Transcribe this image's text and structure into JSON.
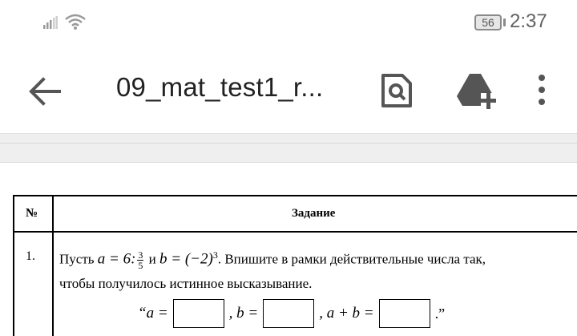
{
  "status_bar": {
    "battery": "56",
    "time": "2:37"
  },
  "app_bar": {
    "title": "09_mat_test1_r...",
    "icons": [
      "back-arrow-icon",
      "find-in-page-icon",
      "drive-add-icon",
      "more-vert-icon"
    ]
  },
  "document": {
    "table": {
      "headers": {
        "number": "№",
        "task": "Задание"
      },
      "rows": [
        {
          "number": "1.",
          "text_prefix": "Пусть ",
          "a_eq": "a = 6:",
          "frac_num": "3",
          "frac_den": "5",
          "and": " и ",
          "b_eq": "b = (−2)",
          "b_exp": "3",
          "text_suffix": ". Впишите в рамки действительные числа так,",
          "text_line2": "чтобы получилось истинное высказывание.",
          "answer": {
            "open_quote_a": "“a =",
            "sep_b": ",  b =",
            "sep_sum": ",  a + b =",
            "close": ".”"
          }
        }
      ]
    }
  }
}
